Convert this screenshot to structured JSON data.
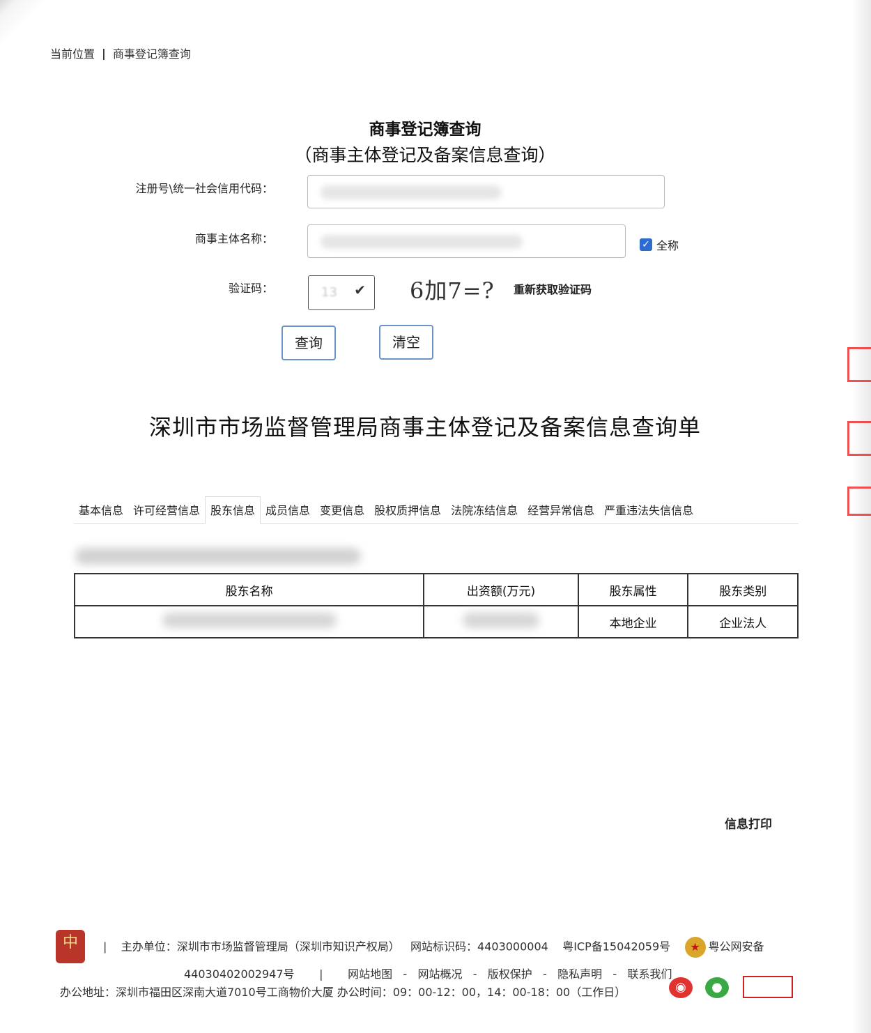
{
  "breadcrumb": {
    "label": "当前位置",
    "current": "商事登记簿查询"
  },
  "search_form": {
    "title": "商事登记簿查询",
    "subtitle": "（商事主体登记及备案信息查询）",
    "reg_no_label": "注册号\\统一社会信用代码：",
    "name_label": "商事主体名称：",
    "full_name_checkbox_label": "全称",
    "captcha_label": "验证码：",
    "captcha_value": "13",
    "captcha_challenge": "6加7=?",
    "refresh_captcha": "重新获取验证码",
    "query_button": "查询",
    "clear_button": "清空"
  },
  "report": {
    "title": "深圳市市场监督管理局商事主体登记及备案信息查询单",
    "tabs": [
      {
        "label": "基本信息"
      },
      {
        "label": "许可经营信息"
      },
      {
        "label": "股东信息"
      },
      {
        "label": "成员信息"
      },
      {
        "label": "变更信息"
      },
      {
        "label": "股权质押信息"
      },
      {
        "label": "法院冻结信息"
      },
      {
        "label": "经营异常信息"
      },
      {
        "label": "严重违法失信信息"
      }
    ],
    "active_tab": "股东信息",
    "table": {
      "headers": [
        "股东名称",
        "出资额(万元)",
        "股东属性",
        "股东类别"
      ],
      "rows": [
        {
          "attribute": "本地企业",
          "category": "企业法人"
        }
      ]
    },
    "print_link": "信息打印"
  },
  "footer": {
    "sponsor": "主办单位：深圳市市场监督管理局（深圳市知识产权局）",
    "site_id": "网站标识码：4403000004",
    "icp": "粤ICP备15042059号",
    "police_label": "粤公网安备",
    "police_no": "44030402002947号",
    "links": [
      "网站地图",
      "网站概况",
      "版权保护",
      "隐私声明",
      "联系我们"
    ],
    "address": "办公地址：深圳市福田区深南大道7010号工商物价大厦 办公时间：09：00-12：00，14：00-18：00（工作日）"
  },
  "colors": {
    "button_border": "#6a93c9",
    "checkbox": "#2c6bd0",
    "stamp": "#e33333"
  }
}
